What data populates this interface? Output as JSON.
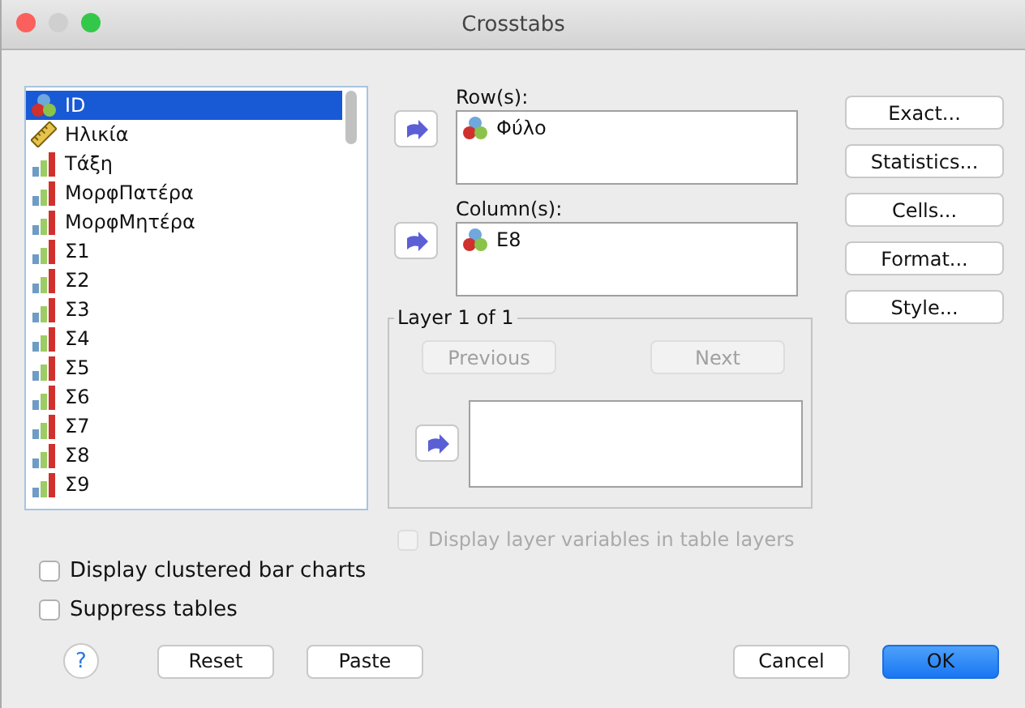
{
  "window": {
    "title": "Crosstabs"
  },
  "variables": [
    {
      "name": "ID",
      "kind": "nominal",
      "selected": true
    },
    {
      "name": "Ηλικία",
      "kind": "scale",
      "selected": false
    },
    {
      "name": "Τάξη",
      "kind": "ordinal",
      "selected": false
    },
    {
      "name": "ΜορφΠατέρα",
      "kind": "ordinal",
      "selected": false
    },
    {
      "name": "ΜορφΜητέρα",
      "kind": "ordinal",
      "selected": false
    },
    {
      "name": "Σ1",
      "kind": "ordinal",
      "selected": false
    },
    {
      "name": "Σ2",
      "kind": "ordinal",
      "selected": false
    },
    {
      "name": "Σ3",
      "kind": "ordinal",
      "selected": false
    },
    {
      "name": "Σ4",
      "kind": "ordinal",
      "selected": false
    },
    {
      "name": "Σ5",
      "kind": "ordinal",
      "selected": false
    },
    {
      "name": "Σ6",
      "kind": "ordinal",
      "selected": false
    },
    {
      "name": "Σ7",
      "kind": "ordinal",
      "selected": false
    },
    {
      "name": "Σ8",
      "kind": "ordinal",
      "selected": false
    },
    {
      "name": "Σ9",
      "kind": "ordinal",
      "selected": false
    }
  ],
  "rows": {
    "label": "Row(s):",
    "items": [
      {
        "name": "Φύλο",
        "kind": "nominal"
      }
    ]
  },
  "columns": {
    "label": "Column(s):",
    "items": [
      {
        "name": "E8",
        "kind": "nominal"
      }
    ]
  },
  "layer": {
    "title": "Layer 1 of 1",
    "previous": {
      "label": "Previous",
      "disabled": true
    },
    "next": {
      "label": "Next",
      "disabled": true
    }
  },
  "layer_option": {
    "label": "Display layer variables in table layers",
    "checked": false,
    "disabled": true
  },
  "side_buttons": [
    "Exact...",
    "Statistics...",
    "Cells...",
    "Format...",
    "Style..."
  ],
  "options": [
    {
      "label": "Display clustered bar charts",
      "checked": false,
      "disabled": false
    },
    {
      "label": "Suppress tables",
      "checked": false,
      "disabled": false
    }
  ],
  "footer": {
    "help": "?",
    "buttons": [
      {
        "label": "Reset",
        "default": false
      },
      {
        "label": "Paste",
        "default": false
      }
    ],
    "actions": [
      {
        "label": "Cancel",
        "default": false
      },
      {
        "label": "OK",
        "default": true
      }
    ]
  }
}
